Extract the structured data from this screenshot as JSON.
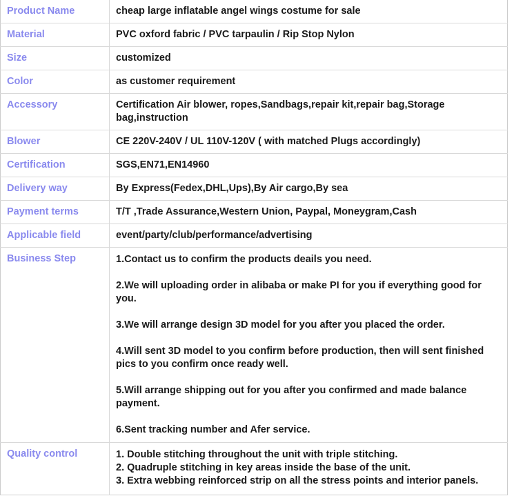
{
  "table": {
    "label_color": "#8a8aee",
    "value_color": "#1a1a1a",
    "border_color": "#d9d9d9",
    "rows": [
      {
        "label": "Product Name",
        "value": "cheap large inflatable angel wings costume for sale"
      },
      {
        "label": "Material",
        "value": "PVC oxford fabric / PVC tarpaulin / Rip Stop Nylon"
      },
      {
        "label": "Size",
        "value": "customized"
      },
      {
        "label": "Color",
        "value": "as customer requirement"
      },
      {
        "label": "Accessory",
        "value": "Certification Air blower, ropes,Sandbags,repair kit,repair bag,Storage bag,instruction"
      },
      {
        "label": "Blower",
        "value": "CE 220V-240V / UL 110V-120V ( with matched Plugs accordingly)"
      },
      {
        "label": "Certification",
        "value": "SGS,EN71,EN14960"
      },
      {
        "label": "Delivery way",
        "value": "By Express(Fedex,DHL,Ups),By Air cargo,By sea"
      },
      {
        "label": "Payment terms",
        "value": "T/T ,Trade Assurance,Western Union, Paypal, Moneygram,Cash"
      },
      {
        "label": "Applicable field",
        "value": "event/party/club/performance/advertising"
      }
    ],
    "business_step": {
      "label": "Business Step",
      "steps": [
        "1.Contact us to confirm the products deails you need.",
        "2.We will uploading order in alibaba or make PI for you if everything good for you.",
        "3.We will arrange design 3D model for you after you placed the order.",
        "4.Will sent 3D model to you confirm before production, then will sent finished pics to you confirm once ready well.",
        "5.Will arrange shipping out for you after you confirmed and made balance payment.",
        "6.Sent tracking number and Afer service."
      ]
    },
    "quality_control": {
      "label": "Quality control",
      "lines": [
        "1. Double stitching throughout the unit with triple stitching.",
        "2. Quadruple stitching in key areas inside the base of the unit.",
        "3. Extra webbing reinforced strip on all the stress points and interior panels."
      ]
    }
  }
}
